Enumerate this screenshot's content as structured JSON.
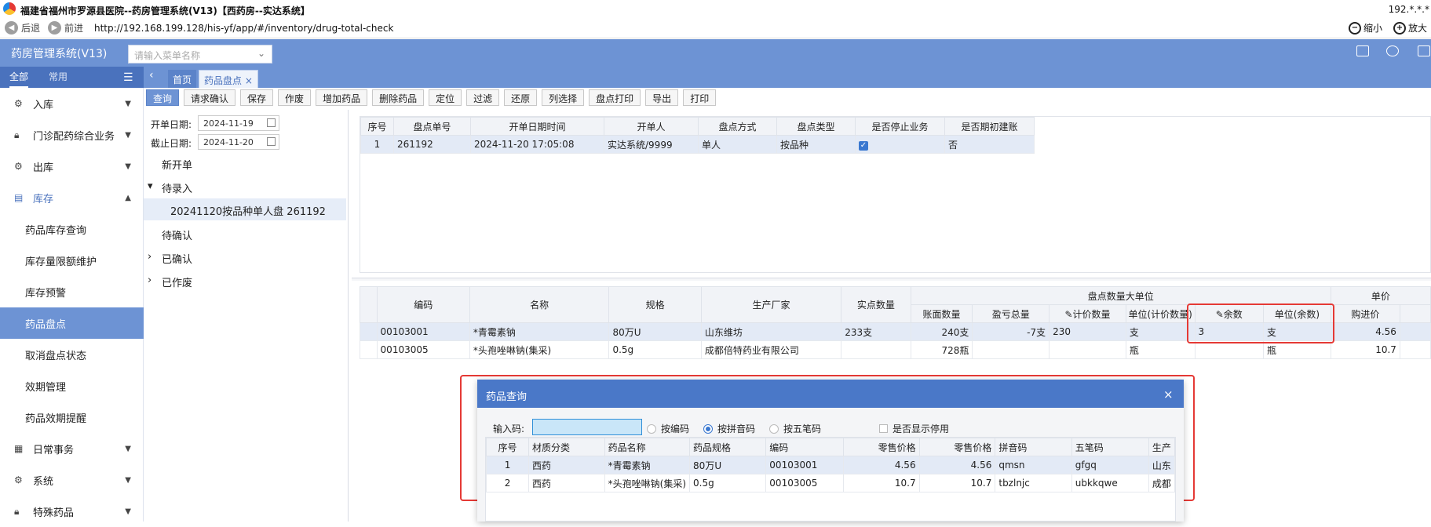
{
  "window": {
    "title": "福建省福州市罗源县医院--药房管理系统(V13)【西药房--实达系统】",
    "ip_partial": "192.*.*.*"
  },
  "browser": {
    "back_label": "后退",
    "forward_label": "前进",
    "url": "http://192.168.199.128/his-yf/app/#/inventory/drug-total-check",
    "zoom_out_label": "缩小",
    "zoom_in_label": "放大"
  },
  "app": {
    "name": "药房管理系统(V13)",
    "menu_search_placeholder": "请输入菜单名称",
    "side_tabs": [
      "全部",
      "常用"
    ],
    "page_tabs": {
      "home": "首页",
      "current": "药品盘点"
    }
  },
  "sidebar": {
    "items": [
      {
        "label": "入库",
        "icon": "gear-icon"
      },
      {
        "label": "门诊配药综合业务",
        "icon": "lock-icon"
      },
      {
        "label": "出库",
        "icon": "gear-icon"
      },
      {
        "label": "库存",
        "icon": "box-icon"
      }
    ],
    "sub_items": [
      "药品库存查询",
      "库存量限额维护",
      "库存预警",
      "药品盘点",
      "取消盘点状态",
      "效期管理",
      "药品效期提醒"
    ],
    "items_after": [
      {
        "label": "日常事务",
        "icon": "calendar-icon"
      },
      {
        "label": "系统",
        "icon": "gear-icon"
      },
      {
        "label": "特殊药品",
        "icon": "lock-icon"
      }
    ]
  },
  "toolbar": [
    "查询",
    "请求确认",
    "保存",
    "作废",
    "增加药品",
    "删除药品",
    "定位",
    "过滤",
    "还原",
    "列选择",
    "盘点打印",
    "导出",
    "打印"
  ],
  "filters": {
    "start_label": "开单日期:",
    "start_value": "2024-11-19",
    "end_label": "截止日期:",
    "end_value": "2024-11-20"
  },
  "tree": {
    "new": "新开单",
    "pending_entry": "待录入",
    "pending_child": "20241120按品种单人盘 261192",
    "pending_confirm": "待确认",
    "confirmed": "已确认",
    "voided": "已作废"
  },
  "top_table": {
    "headers": [
      "序号",
      "盘点单号",
      "开单日期时间",
      "开单人",
      "盘点方式",
      "盘点类型",
      "是否停止业务",
      "是否期初建账"
    ],
    "rows": [
      [
        "1",
        "261192",
        "2024-11-20 17:05:08",
        "实达系统/9999",
        "单人",
        "按品种",
        "✓",
        "否"
      ]
    ]
  },
  "detail_table": {
    "group_header": "盘点数量大单位",
    "right_group_header": "单价",
    "headers": [
      "编码",
      "名称",
      "规格",
      "生产厂家",
      "实点数量",
      "账面数量",
      "盈亏总量",
      "计价数量",
      "单位(计价数量)",
      "余数",
      "单位(余数)",
      "购进价"
    ],
    "rows": [
      [
        "00103001",
        "*青霉素钠",
        "80万U",
        "山东维坊",
        "233支",
        "240支",
        "-7支",
        "230",
        "支",
        "3",
        "支",
        "4.56"
      ],
      [
        "00103005",
        "*头孢唑啉钠(集采)",
        "0.5g",
        "成都倍特药业有限公司",
        "",
        "728瓶",
        "",
        "",
        "瓶",
        "",
        "瓶",
        "10.7"
      ]
    ]
  },
  "modal": {
    "title": "药品查询",
    "input_label": "输入码:",
    "options": [
      "按编码",
      "按拼音码",
      "按五笔码"
    ],
    "selected_option": "按拼音码",
    "show_disabled_label": "是否显示停用",
    "headers": [
      "序号",
      "材质分类",
      "药品名称",
      "药品规格",
      "编码",
      "零售价格",
      "零售价格",
      "拼音码",
      "五笔码",
      "生产"
    ],
    "rows": [
      [
        "1",
        "西药",
        "*青霉素钠",
        "80万U",
        "00103001",
        "4.56",
        "4.56",
        "qmsn",
        "gfgq",
        "山东"
      ],
      [
        "2",
        "西药",
        "*头孢唑啉钠(集采)",
        "0.5g",
        "00103005",
        "10.7",
        "10.7",
        "tbzlnjc",
        "ubkkqwe",
        "成都"
      ]
    ]
  }
}
